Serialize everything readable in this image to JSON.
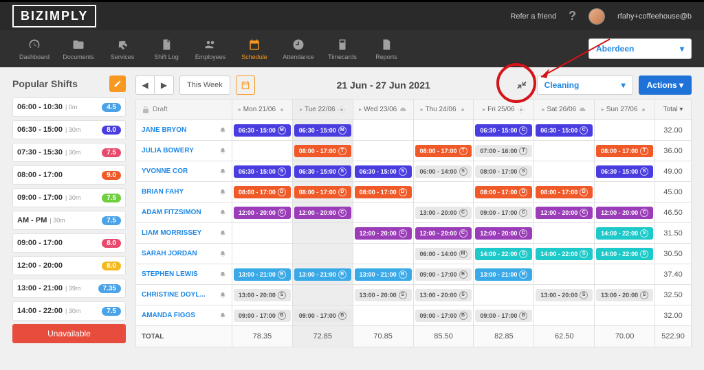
{
  "header": {
    "brand": "BIZIMPLY",
    "refer": "Refer a friend",
    "username": "rfahy+coffeehouse@b"
  },
  "nav": {
    "items": [
      {
        "label": "Dashboard"
      },
      {
        "label": "Documents"
      },
      {
        "label": "Services"
      },
      {
        "label": "Shift Log"
      },
      {
        "label": "Employees"
      },
      {
        "label": "Schedule"
      },
      {
        "label": "Attendance"
      },
      {
        "label": "Timecards"
      },
      {
        "label": "Reports"
      }
    ],
    "location": "Aberdeen"
  },
  "popular": {
    "title": "Popular Shifts",
    "shifts": [
      {
        "time": "06:00 - 10:30",
        "dur": "0m",
        "badge": "4.5",
        "color": "#4aa3e8"
      },
      {
        "time": "06:30 - 15:00",
        "dur": "30m",
        "badge": "8.0",
        "color": "#4a3de0"
      },
      {
        "time": "07:30 - 15:30",
        "dur": "30m",
        "badge": "7.5",
        "color": "#e84a6e"
      },
      {
        "time": "08:00 - 17:00",
        "dur": "",
        "badge": "9.0",
        "color": "#f05a28"
      },
      {
        "time": "09:00 - 17:00",
        "dur": "30m",
        "badge": "7.5",
        "color": "#6ecf3f"
      },
      {
        "time": "AM - PM",
        "dur": "30m",
        "badge": "7.5",
        "color": "#4aa3e8"
      },
      {
        "time": "09:00 - 17:00",
        "dur": "",
        "badge": "8.0",
        "color": "#e84a6e"
      },
      {
        "time": "12:00 - 20:00",
        "dur": "",
        "badge": "8.0",
        "color": "#f5b920"
      },
      {
        "time": "13:00 - 21:00",
        "dur": "39m",
        "badge": "7.35",
        "color": "#4aa3e8"
      },
      {
        "time": "14:00 - 22:00",
        "dur": "30m",
        "badge": "7.5",
        "color": "#4aa3e8"
      }
    ],
    "unavailable": "Unavailable"
  },
  "toolbar": {
    "this_week": "This Week",
    "range": "21 Jun - 27 Jun 2021",
    "department": "Cleaning",
    "actions": "Actions"
  },
  "schedule": {
    "draft": "Draft",
    "days": [
      "Mon 21/06",
      "Tue 22/06",
      "Wed 23/06",
      "Thu 24/06",
      "Fri 25/06",
      "Sat 26/06",
      "Sun 27/06"
    ],
    "total_header": "Total",
    "rows": [
      {
        "name": "JANE BRYON",
        "shifts": [
          {
            "d": 0,
            "t": "06:30 - 15:00",
            "c": "#4a3de0",
            "g": "M"
          },
          {
            "d": 1,
            "t": "06:30 - 15:00",
            "c": "#4a3de0",
            "g": "M"
          },
          {
            "d": 4,
            "t": "06:30 - 15:00",
            "c": "#4a3de0",
            "g": "C"
          },
          {
            "d": 5,
            "t": "06:30 - 15:00",
            "c": "#4a3de0",
            "g": "C"
          }
        ],
        "total": "32.00"
      },
      {
        "name": "JULIA BOWERY",
        "shifts": [
          {
            "d": 1,
            "t": "08:00 - 17:00",
            "c": "#f05a28",
            "g": "T"
          },
          {
            "d": 3,
            "t": "08:00 - 17:00",
            "c": "#f05a28",
            "g": "T"
          },
          {
            "d": 4,
            "t": "07:00 - 16:00",
            "c": "#e8e8e8",
            "tc": "#555",
            "g": "T"
          },
          {
            "d": 6,
            "t": "08:00 - 17:00",
            "c": "#f05a28",
            "g": "T"
          }
        ],
        "total": "36.00"
      },
      {
        "name": "YVONNE COR",
        "shifts": [
          {
            "d": 0,
            "t": "06:30 - 15:00",
            "c": "#4a3de0",
            "g": "S"
          },
          {
            "d": 1,
            "t": "06:30 - 15:00",
            "c": "#4a3de0",
            "g": "S"
          },
          {
            "d": 2,
            "t": "06:30 - 15:00",
            "c": "#4a3de0",
            "g": "S"
          },
          {
            "d": 3,
            "t": "06:00 - 14:00",
            "c": "#e8e8e8",
            "tc": "#555",
            "g": "S"
          },
          {
            "d": 4,
            "t": "08:00 - 17:00",
            "c": "#e8e8e8",
            "tc": "#555",
            "g": "S"
          },
          {
            "d": 6,
            "t": "06:30 - 15:00",
            "c": "#4a3de0",
            "g": "S"
          }
        ],
        "total": "49.00"
      },
      {
        "name": "BRIAN FAHY",
        "shifts": [
          {
            "d": 0,
            "t": "08:00 - 17:00",
            "c": "#f05a28",
            "g": "D"
          },
          {
            "d": 1,
            "t": "08:00 - 17:00",
            "c": "#f05a28",
            "g": "D"
          },
          {
            "d": 2,
            "t": "08:00 - 17:00",
            "c": "#f05a28",
            "g": "D"
          },
          {
            "d": 4,
            "t": "08:00 - 17:00",
            "c": "#f05a28",
            "g": "D"
          },
          {
            "d": 5,
            "t": "08:00 - 17:00",
            "c": "#f05a28",
            "g": "D"
          }
        ],
        "total": "45.00"
      },
      {
        "name": "ADAM FITZSIMON",
        "shifts": [
          {
            "d": 0,
            "t": "12:00 - 20:00",
            "c": "#9b3db8",
            "g": "C"
          },
          {
            "d": 1,
            "t": "12:00 - 20:00",
            "c": "#9b3db8",
            "g": "C"
          },
          {
            "d": 3,
            "t": "13:00 - 20:00",
            "c": "#e8e8e8",
            "tc": "#555",
            "g": "C"
          },
          {
            "d": 4,
            "t": "09:00 - 17:00",
            "c": "#e8e8e8",
            "tc": "#555",
            "g": "C"
          },
          {
            "d": 5,
            "t": "12:00 - 20:00",
            "c": "#9b3db8",
            "g": "C"
          },
          {
            "d": 6,
            "t": "12:00 - 20:00",
            "c": "#9b3db8",
            "g": "C"
          }
        ],
        "total": "46.50"
      },
      {
        "name": "LIAM MORRISSEY",
        "shifts": [
          {
            "d": 2,
            "t": "12:00 - 20:00",
            "c": "#9b3db8",
            "g": "C"
          },
          {
            "d": 3,
            "t": "12:00 - 20:00",
            "c": "#9b3db8",
            "g": "C"
          },
          {
            "d": 4,
            "t": "12:00 - 20:00",
            "c": "#9b3db8",
            "g": "C"
          },
          {
            "d": 6,
            "t": "14:00 - 22:00",
            "c": "#1ec9c9",
            "g": "S"
          }
        ],
        "total": "31.50"
      },
      {
        "name": "SARAH JORDAN",
        "shifts": [
          {
            "d": 3,
            "t": "06:00 - 14:00",
            "c": "#e8e8e8",
            "tc": "#555",
            "g": "M"
          },
          {
            "d": 4,
            "t": "14:00 - 22:00",
            "c": "#1ec9c9",
            "g": "S"
          },
          {
            "d": 5,
            "t": "14:00 - 22:00",
            "c": "#1ec9c9",
            "g": "S"
          },
          {
            "d": 6,
            "t": "14:00 - 22:00",
            "c": "#1ec9c9",
            "g": "S"
          }
        ],
        "total": "30.50"
      },
      {
        "name": "STEPHEN LEWIS",
        "shifts": [
          {
            "d": 0,
            "t": "13:00 - 21:00",
            "c": "#3aa9e8",
            "g": "B"
          },
          {
            "d": 1,
            "t": "13:00 - 21:00",
            "c": "#3aa9e8",
            "g": "B"
          },
          {
            "d": 2,
            "t": "13:00 - 21:00",
            "c": "#3aa9e8",
            "g": "B"
          },
          {
            "d": 3,
            "t": "09:00 - 17:00",
            "c": "#e8e8e8",
            "tc": "#555",
            "g": "B"
          },
          {
            "d": 4,
            "t": "13:00 - 21:00",
            "c": "#3aa9e8",
            "g": "B"
          }
        ],
        "total": "37.40"
      },
      {
        "name": "CHRISTINE DOYL...",
        "shifts": [
          {
            "d": 0,
            "t": "13:00 - 20:00",
            "c": "#e8e8e8",
            "tc": "#555",
            "g": "S"
          },
          {
            "d": 2,
            "t": "13:00 - 20:00",
            "c": "#e8e8e8",
            "tc": "#555",
            "g": "S"
          },
          {
            "d": 3,
            "t": "13:00 - 20:00",
            "c": "#e8e8e8",
            "tc": "#555",
            "g": "S"
          },
          {
            "d": 5,
            "t": "13:00 - 20:00",
            "c": "#e8e8e8",
            "tc": "#555",
            "g": "S"
          },
          {
            "d": 6,
            "t": "13:00 - 20:00",
            "c": "#e8e8e8",
            "tc": "#555",
            "g": "S"
          }
        ],
        "total": "32.50"
      },
      {
        "name": "AMANDA FIGGS",
        "shifts": [
          {
            "d": 0,
            "t": "09:00 - 17:00",
            "c": "#e8e8e8",
            "tc": "#555",
            "g": "B"
          },
          {
            "d": 1,
            "t": "09:00 - 17:00",
            "c": "#e8e8e8",
            "tc": "#555",
            "g": "B"
          },
          {
            "d": 3,
            "t": "09:00 - 17:00",
            "c": "#e8e8e8",
            "tc": "#555",
            "g": "B"
          },
          {
            "d": 4,
            "t": "09:00 - 17:00",
            "c": "#e8e8e8",
            "tc": "#555",
            "g": "B"
          }
        ],
        "total": "32.00"
      }
    ],
    "total_label": "TOTAL",
    "day_totals": [
      "78.35",
      "72.85",
      "70.85",
      "85.50",
      "82.85",
      "62.50",
      "70.00"
    ],
    "grand_total": "522.90"
  }
}
